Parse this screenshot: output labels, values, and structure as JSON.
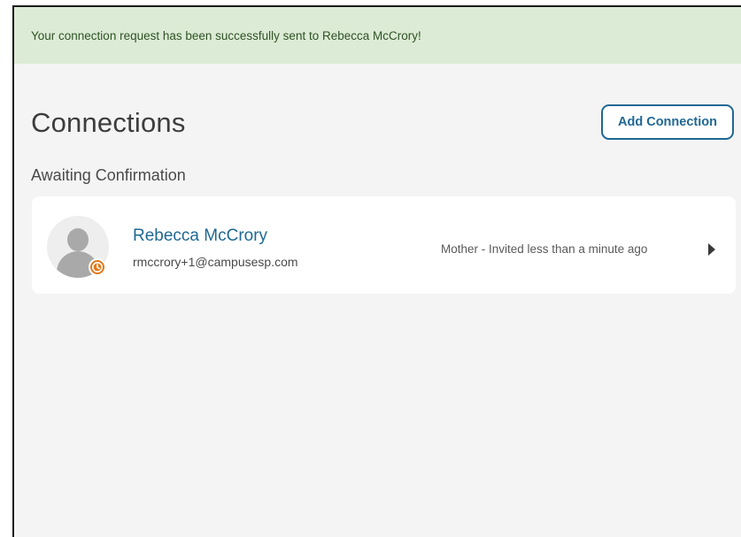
{
  "alert": {
    "message": "Your connection request has been successfully sent to Rebecca McCrory!"
  },
  "page": {
    "title": "Connections",
    "add_button_label": "Add Connection"
  },
  "awaiting": {
    "heading": "Awaiting Confirmation",
    "items": [
      {
        "name": "Rebecca McCrory",
        "email": "rmccrory+1@campusesp.com",
        "status": "Mother - Invited less than a minute ago",
        "avatar_icon": "person-placeholder-icon",
        "badge_icon": "clock-icon"
      }
    ]
  },
  "colors": {
    "alert_bg": "#dcebd5",
    "alert_text": "#2f5226",
    "accent": "#1f6894",
    "pending": "#e07a1c",
    "page_bg": "#f4f4f4"
  }
}
